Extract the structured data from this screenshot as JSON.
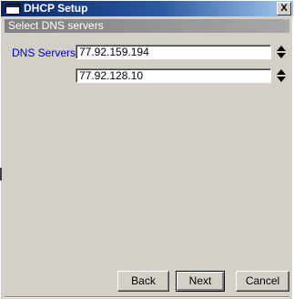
{
  "window": {
    "title": "DHCP Setup",
    "close_glyph": "X"
  },
  "section": {
    "header": "Select DNS servers"
  },
  "dns": {
    "label": "DNS Servers:",
    "servers": [
      "77.92.159.194",
      "77.92.128.10"
    ]
  },
  "buttons": {
    "back": "Back",
    "next": "Next",
    "cancel": "Cancel"
  },
  "colors": {
    "title_gradient_start": "#0a246a",
    "title_gradient_end": "#a6caf0",
    "label_blue": "#0000cc",
    "dialog_face": "#d4d0c8"
  }
}
